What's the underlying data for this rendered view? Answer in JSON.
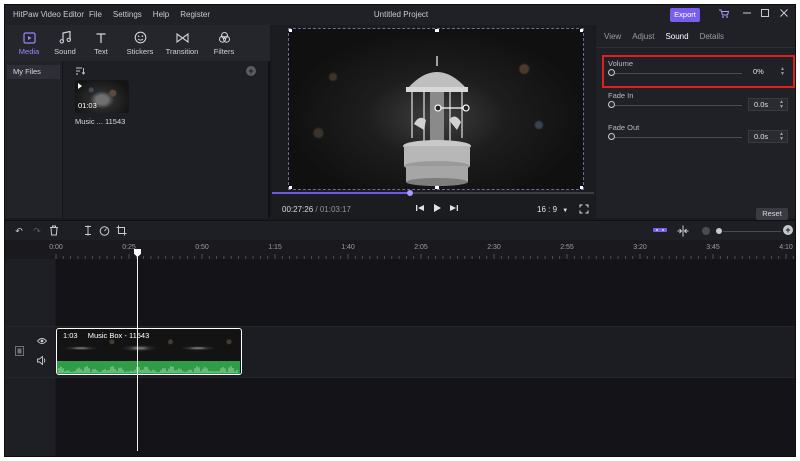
{
  "titlebar": {
    "app_title": "HitPaw Video Editor",
    "menu": [
      "File",
      "Settings",
      "Help",
      "Register"
    ],
    "document_title": "Untitled Project",
    "export_label": "Export"
  },
  "media": {
    "tabs": [
      {
        "label": "Media",
        "icon": "media-icon",
        "active": true
      },
      {
        "label": "Sound",
        "icon": "music-note-icon"
      },
      {
        "label": "Text",
        "icon": "text-icon"
      },
      {
        "label": "Stickers",
        "icon": "smiley-icon"
      },
      {
        "label": "Transition",
        "icon": "transition-icon"
      },
      {
        "label": "Filters",
        "icon": "filters-icon"
      }
    ],
    "side_nav": [
      "My Files"
    ],
    "item": {
      "duration": "01:03",
      "name": "Music ... 11543"
    }
  },
  "preview": {
    "current_time": "00:27:26",
    "total_time": "/ 01:03:17",
    "aspect_ratio": "16 : 9",
    "progress": 0.43
  },
  "props": {
    "tabs": [
      "View",
      "Adjust",
      "Sound",
      "Details"
    ],
    "active_tab": "Sound",
    "volume": {
      "label": "Volume",
      "value": "0%"
    },
    "fade_in": {
      "label": "Fade In",
      "value": "0.0s"
    },
    "fade_out": {
      "label": "Fade Out",
      "value": "0.0s"
    },
    "reset_label": "Reset"
  },
  "timeline": {
    "ruler": [
      "0:00",
      "0:25",
      "0:50",
      "1:15",
      "1:40",
      "2:05",
      "2:30",
      "2:55",
      "3:20",
      "3:45",
      "4:10"
    ],
    "clip": {
      "duration": "1:03",
      "name": "Music Box - 11543"
    }
  },
  "colors": {
    "accent": "#7b5cf0",
    "audio_track": "#2f9c47",
    "highlight": "#e02020"
  }
}
